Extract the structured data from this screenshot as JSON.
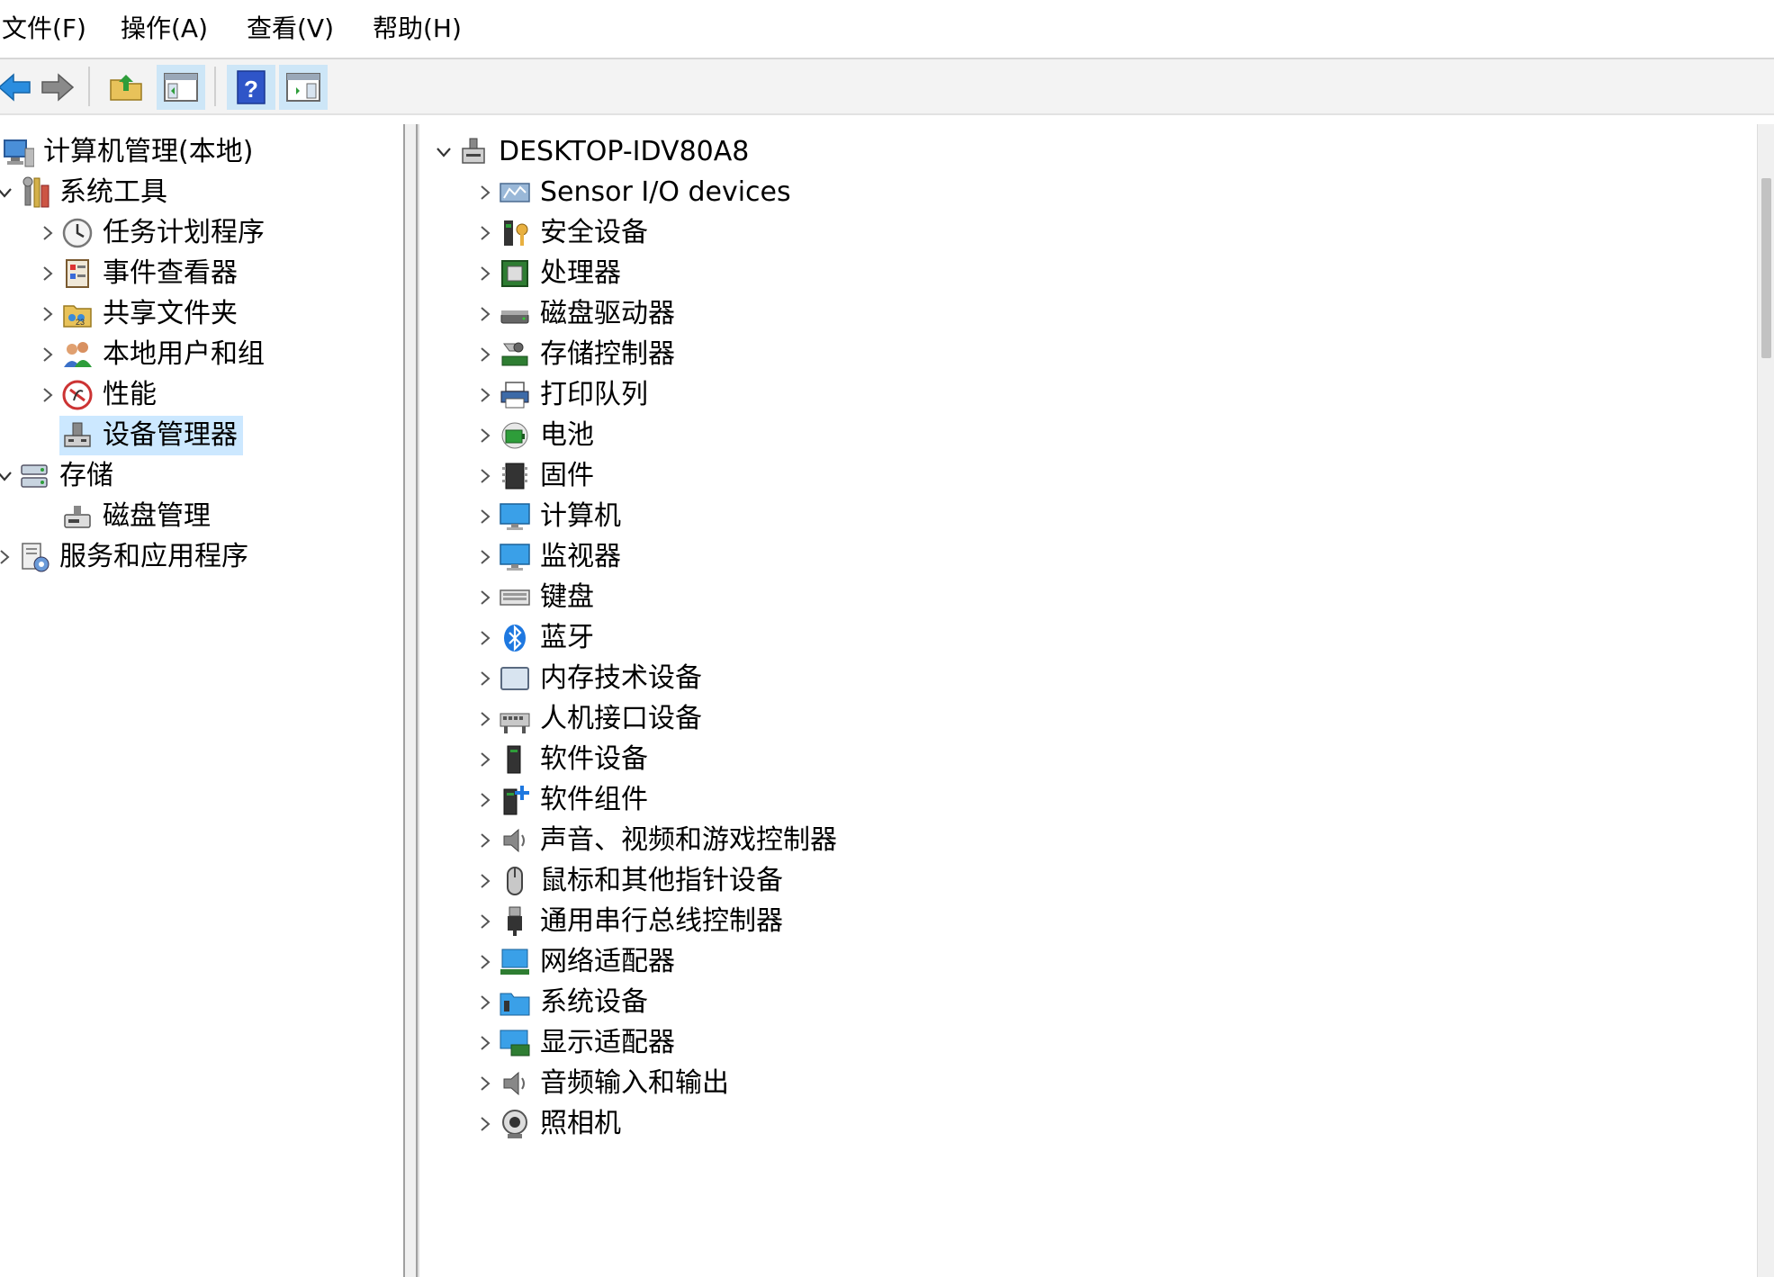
{
  "menu": [
    "文件(F)",
    "操作(A)",
    "查看(V)",
    "帮助(H)"
  ],
  "toolbar": {
    "buttons": [
      "back-arrow-icon",
      "forward-arrow-icon",
      "up-folder-icon",
      "show-hide-console-tree-icon",
      "help-icon",
      "show-hide-action-pane-icon"
    ]
  },
  "left_tree": [
    {
      "label": "计算机管理(本地)",
      "icon": "computer-management-icon",
      "level": 0,
      "expander": "none"
    },
    {
      "label": "系统工具",
      "icon": "system-tools-icon",
      "level": 1,
      "expander": "expanded"
    },
    {
      "label": "任务计划程序",
      "icon": "task-scheduler-icon",
      "level": 2,
      "expander": "collapsed"
    },
    {
      "label": "事件查看器",
      "icon": "event-viewer-icon",
      "level": 2,
      "expander": "collapsed"
    },
    {
      "label": "共享文件夹",
      "icon": "shared-folders-icon",
      "level": 2,
      "expander": "collapsed"
    },
    {
      "label": "本地用户和组",
      "icon": "local-users-groups-icon",
      "level": 2,
      "expander": "collapsed"
    },
    {
      "label": "性能",
      "icon": "performance-icon",
      "level": 2,
      "expander": "collapsed"
    },
    {
      "label": "设备管理器",
      "icon": "device-manager-icon",
      "level": 2,
      "expander": "none",
      "selected": true
    },
    {
      "label": "存储",
      "icon": "storage-icon",
      "level": 1,
      "expander": "expanded"
    },
    {
      "label": "磁盘管理",
      "icon": "disk-management-icon",
      "level": 2,
      "expander": "none"
    },
    {
      "label": "服务和应用程序",
      "icon": "services-apps-icon",
      "level": 1,
      "expander": "collapsed"
    }
  ],
  "device_tree": {
    "root": {
      "label": "DESKTOP-IDV80A8",
      "icon": "computer-root-icon"
    },
    "categories": [
      {
        "label": "Sensor I/O devices",
        "icon": "sensor-icon"
      },
      {
        "label": "安全设备",
        "icon": "security-device-icon"
      },
      {
        "label": "处理器",
        "icon": "processor-icon"
      },
      {
        "label": "磁盘驱动器",
        "icon": "disk-drive-icon"
      },
      {
        "label": "存储控制器",
        "icon": "storage-controller-icon"
      },
      {
        "label": "打印队列",
        "icon": "printer-icon"
      },
      {
        "label": "电池",
        "icon": "battery-icon"
      },
      {
        "label": "固件",
        "icon": "firmware-icon"
      },
      {
        "label": "计算机",
        "icon": "computer-icon"
      },
      {
        "label": "监视器",
        "icon": "monitor-icon"
      },
      {
        "label": "键盘",
        "icon": "keyboard-icon"
      },
      {
        "label": "蓝牙",
        "icon": "bluetooth-icon"
      },
      {
        "label": "内存技术设备",
        "icon": "memory-device-icon"
      },
      {
        "label": "人机接口设备",
        "icon": "hid-icon"
      },
      {
        "label": "软件设备",
        "icon": "software-device-icon"
      },
      {
        "label": "软件组件",
        "icon": "software-component-icon"
      },
      {
        "label": "声音、视频和游戏控制器",
        "icon": "speaker-icon"
      },
      {
        "label": "鼠标和其他指针设备",
        "icon": "mouse-icon"
      },
      {
        "label": "通用串行总线控制器",
        "icon": "usb-icon"
      },
      {
        "label": "网络适配器",
        "icon": "network-adapter-icon"
      },
      {
        "label": "系统设备",
        "icon": "system-device-icon"
      },
      {
        "label": "显示适配器",
        "icon": "display-adapter-icon"
      },
      {
        "label": "音频输入和输出",
        "icon": "audio-io-icon"
      },
      {
        "label": "照相机",
        "icon": "camera-icon"
      }
    ]
  }
}
